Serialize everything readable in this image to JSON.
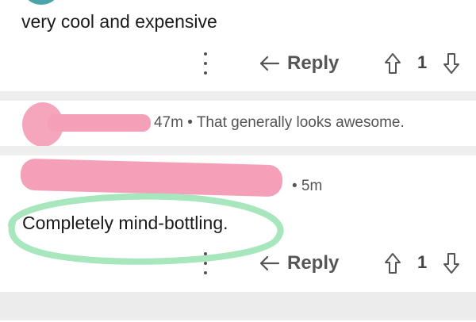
{
  "comment1": {
    "text": "very cool and expensive",
    "reply_label": "Reply",
    "score": "1"
  },
  "collapsed_comment": {
    "meta": "47m • That generally looks awesome."
  },
  "comment2": {
    "age": "• 5m",
    "text": "Completely mind-bottling.",
    "reply_label": "Reply",
    "score": "1"
  },
  "colors": {
    "accent_pink": "#f4a0b8",
    "highlight_green": "#a8e6bd",
    "avatar_teal": "#4aa5a8",
    "divider": "#eeeeee"
  },
  "icons": {
    "more": "kebab-icon",
    "reply": "reply-arrow-icon",
    "upvote": "upvote-arrow-icon",
    "downvote": "downvote-arrow-icon"
  }
}
